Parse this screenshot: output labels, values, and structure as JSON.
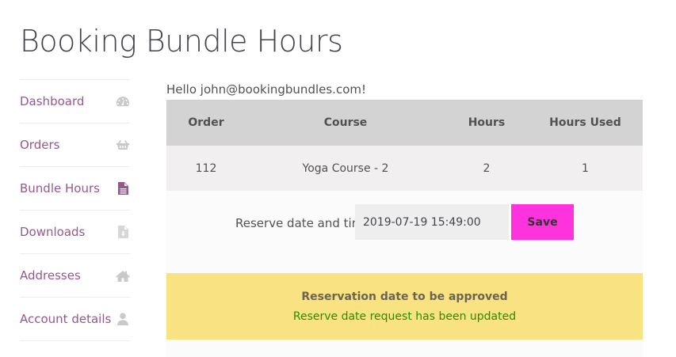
{
  "page": {
    "title": "Booking Bundle Hours"
  },
  "sidebar": {
    "items": [
      {
        "label": "Dashboard",
        "icon": "dashboard-icon"
      },
      {
        "label": "Orders",
        "icon": "basket-icon"
      },
      {
        "label": "Bundle Hours",
        "icon": "document-icon",
        "active": true
      },
      {
        "label": "Downloads",
        "icon": "file-download-icon"
      },
      {
        "label": "Addresses",
        "icon": "home-icon"
      },
      {
        "label": "Account details",
        "icon": "user-icon"
      }
    ]
  },
  "main": {
    "greeting": "Hello john@bookingbundles.com!",
    "table": {
      "headers": [
        "Order",
        "Course",
        "Hours",
        "Hours Used"
      ],
      "rows": [
        [
          "112",
          "Yoga Course - 2",
          "2",
          "1"
        ]
      ]
    },
    "reserve": {
      "label": "Reserve date and time",
      "value": "2019-07-19 15:49:00",
      "save_label": "Save"
    },
    "notice": {
      "title": "Reservation date to be approved",
      "message": "Reserve date request has been updated"
    }
  },
  "colors": {
    "link": "#96588a",
    "save_button": "#ff33dd",
    "notice_bg": "#f8e281",
    "success_text": "#2e8b00",
    "table_header": "#d3d3d3"
  }
}
